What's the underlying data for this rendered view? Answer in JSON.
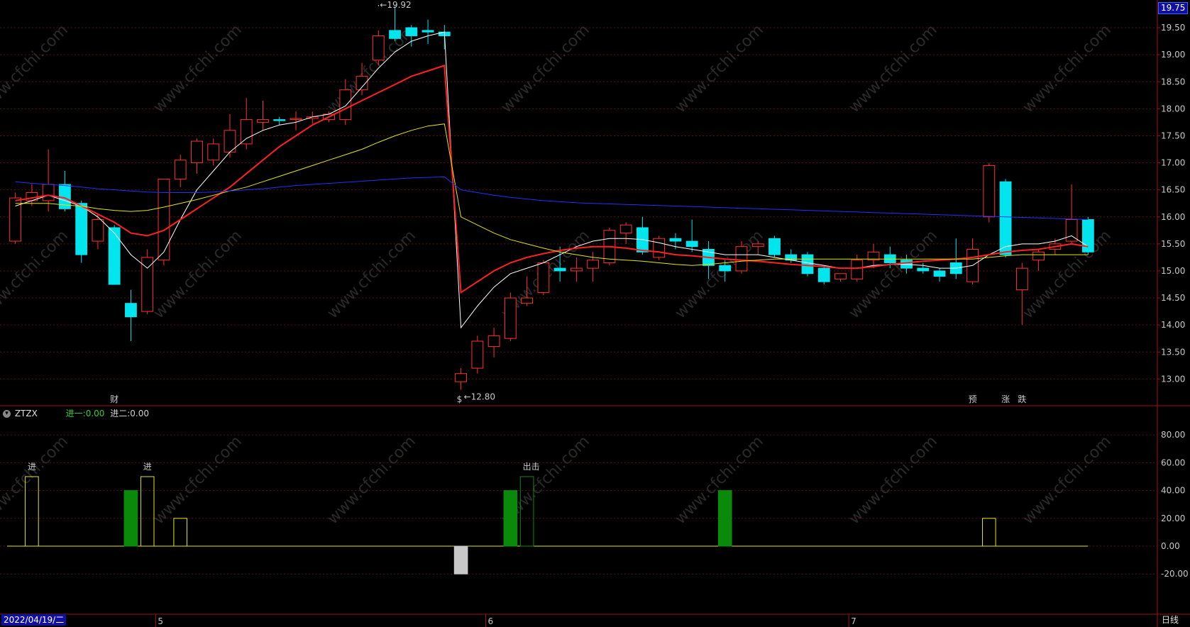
{
  "price_scale": {
    "ticks": [
      "19.50",
      "19.00",
      "18.50",
      "18.00",
      "17.50",
      "17.00",
      "16.50",
      "16.00",
      "15.50",
      "15.00",
      "14.50",
      "14.00",
      "13.50",
      "13.00"
    ],
    "last_price": "19.75",
    "high_label": "19.92",
    "low_label": "12.80",
    "high_arrow": "←19.92",
    "low_arrow": "←12.80"
  },
  "event_markers": [
    {
      "text": "财",
      "color": "#4aa3ff"
    },
    {
      "text": "$",
      "color": "#ff3030"
    },
    {
      "text": "预",
      "color": "#ff8c00"
    },
    {
      "text": "涨",
      "color": "#ff3030"
    },
    {
      "text": "跌",
      "color": "#30ff30"
    }
  ],
  "indicator": {
    "name": "ZTZX",
    "v1_label": "进一:",
    "v1_value": "0.00",
    "v2_label": "进二:",
    "v2_value": "0.00",
    "ticks": [
      "80.00",
      "60.00",
      "40.00",
      "20.00",
      "0.00",
      "-20.00"
    ],
    "annotations": [
      "进",
      "进",
      "出击"
    ]
  },
  "time_axis": {
    "date_label": "2022/04/19/二",
    "month_labels": [
      "5",
      "6",
      "7"
    ],
    "period": "日线"
  },
  "watermark": "www.cfchi.com",
  "chart_data": [
    {
      "type": "candlestick",
      "ylim": [
        12.6,
        19.8
      ],
      "candles": [
        {
          "o": 15.55,
          "h": 16.45,
          "l": 15.5,
          "c": 16.35
        },
        {
          "o": 16.3,
          "h": 16.6,
          "l": 16.2,
          "c": 16.45
        },
        {
          "o": 16.3,
          "h": 17.25,
          "l": 16.1,
          "c": 16.6
        },
        {
          "o": 16.6,
          "h": 16.85,
          "l": 16.1,
          "c": 16.15
        },
        {
          "o": 16.25,
          "h": 16.3,
          "l": 15.15,
          "c": 15.3
        },
        {
          "o": 15.55,
          "h": 16.05,
          "l": 15.4,
          "c": 15.95
        },
        {
          "o": 15.8,
          "h": 15.85,
          "l": 14.75,
          "c": 14.75
        },
        {
          "o": 14.4,
          "h": 14.65,
          "l": 13.7,
          "c": 14.15
        },
        {
          "o": 14.25,
          "h": 15.4,
          "l": 14.2,
          "c": 15.25
        },
        {
          "o": 15.2,
          "h": 16.7,
          "l": 15.1,
          "c": 16.7
        },
        {
          "o": 16.7,
          "h": 17.15,
          "l": 16.55,
          "c": 17.05
        },
        {
          "o": 17.0,
          "h": 17.45,
          "l": 16.8,
          "c": 17.4
        },
        {
          "o": 17.05,
          "h": 17.45,
          "l": 16.95,
          "c": 17.35
        },
        {
          "o": 17.2,
          "h": 17.9,
          "l": 17.1,
          "c": 17.6
        },
        {
          "o": 17.35,
          "h": 18.2,
          "l": 17.25,
          "c": 17.8
        },
        {
          "o": 17.75,
          "h": 18.15,
          "l": 17.6,
          "c": 17.8
        },
        {
          "o": 17.8,
          "h": 17.85,
          "l": 17.7,
          "c": 17.78
        },
        {
          "o": 17.8,
          "h": 17.95,
          "l": 17.6,
          "c": 17.82
        },
        {
          "o": 17.82,
          "h": 17.95,
          "l": 17.72,
          "c": 17.85
        },
        {
          "o": 17.8,
          "h": 17.95,
          "l": 17.75,
          "c": 17.9
        },
        {
          "o": 17.8,
          "h": 18.55,
          "l": 17.7,
          "c": 18.35
        },
        {
          "o": 18.35,
          "h": 18.85,
          "l": 18.25,
          "c": 18.6
        },
        {
          "o": 18.9,
          "h": 19.45,
          "l": 18.8,
          "c": 19.35
        },
        {
          "o": 19.45,
          "h": 19.9,
          "l": 19.25,
          "c": 19.3
        },
        {
          "o": 19.5,
          "h": 19.55,
          "l": 19.15,
          "c": 19.35
        },
        {
          "o": 19.45,
          "h": 19.65,
          "l": 19.2,
          "c": 19.42
        },
        {
          "o": 19.42,
          "h": 19.55,
          "l": 19.1,
          "c": 19.35
        },
        {
          "o": 12.95,
          "h": 13.2,
          "l": 12.8,
          "c": 13.1
        },
        {
          "o": 13.2,
          "h": 13.8,
          "l": 13.1,
          "c": 13.7
        },
        {
          "o": 13.6,
          "h": 13.95,
          "l": 13.4,
          "c": 13.8
        },
        {
          "o": 13.75,
          "h": 14.6,
          "l": 13.7,
          "c": 14.5
        },
        {
          "o": 14.4,
          "h": 14.9,
          "l": 14.35,
          "c": 14.5
        },
        {
          "o": 14.6,
          "h": 15.2,
          "l": 14.55,
          "c": 15.15
        },
        {
          "o": 15.05,
          "h": 15.45,
          "l": 14.8,
          "c": 15.0
        },
        {
          "o": 15.0,
          "h": 15.25,
          "l": 14.8,
          "c": 15.05
        },
        {
          "o": 15.05,
          "h": 15.35,
          "l": 14.8,
          "c": 15.2
        },
        {
          "o": 15.15,
          "h": 15.8,
          "l": 15.1,
          "c": 15.75
        },
        {
          "o": 15.7,
          "h": 15.9,
          "l": 15.5,
          "c": 15.85
        },
        {
          "o": 15.8,
          "h": 16.0,
          "l": 15.3,
          "c": 15.35
        },
        {
          "o": 15.25,
          "h": 15.65,
          "l": 15.2,
          "c": 15.6
        },
        {
          "o": 15.6,
          "h": 15.7,
          "l": 15.4,
          "c": 15.55
        },
        {
          "o": 15.55,
          "h": 15.95,
          "l": 15.35,
          "c": 15.45
        },
        {
          "o": 15.4,
          "h": 15.55,
          "l": 14.85,
          "c": 15.1
        },
        {
          "o": 15.1,
          "h": 15.2,
          "l": 14.8,
          "c": 15.0
        },
        {
          "o": 15.0,
          "h": 15.55,
          "l": 14.95,
          "c": 15.45
        },
        {
          "o": 15.45,
          "h": 15.55,
          "l": 15.3,
          "c": 15.5
        },
        {
          "o": 15.6,
          "h": 15.65,
          "l": 15.25,
          "c": 15.3
        },
        {
          "o": 15.3,
          "h": 15.4,
          "l": 15.15,
          "c": 15.2
        },
        {
          "o": 15.3,
          "h": 15.35,
          "l": 14.9,
          "c": 14.95
        },
        {
          "o": 15.05,
          "h": 15.1,
          "l": 14.75,
          "c": 14.8
        },
        {
          "o": 14.85,
          "h": 14.95,
          "l": 14.8,
          "c": 14.95
        },
        {
          "o": 14.85,
          "h": 15.3,
          "l": 14.8,
          "c": 15.2
        },
        {
          "o": 15.2,
          "h": 15.5,
          "l": 15.05,
          "c": 15.35
        },
        {
          "o": 15.3,
          "h": 15.45,
          "l": 15.05,
          "c": 15.15
        },
        {
          "o": 15.2,
          "h": 15.3,
          "l": 14.95,
          "c": 15.05
        },
        {
          "o": 15.05,
          "h": 15.15,
          "l": 14.95,
          "c": 15.0
        },
        {
          "o": 15.0,
          "h": 15.05,
          "l": 14.8,
          "c": 14.9
        },
        {
          "o": 15.15,
          "h": 15.6,
          "l": 14.85,
          "c": 14.95
        },
        {
          "o": 14.8,
          "h": 15.6,
          "l": 14.75,
          "c": 15.4
        },
        {
          "o": 16.0,
          "h": 17.0,
          "l": 15.9,
          "c": 16.95
        },
        {
          "o": 16.65,
          "h": 16.7,
          "l": 15.25,
          "c": 15.3
        },
        {
          "o": 14.65,
          "h": 15.15,
          "l": 14.0,
          "c": 15.05
        },
        {
          "o": 15.2,
          "h": 15.4,
          "l": 15.0,
          "c": 15.35
        },
        {
          "o": 15.4,
          "h": 15.6,
          "l": 15.3,
          "c": 15.5
        },
        {
          "o": 15.55,
          "h": 16.6,
          "l": 15.5,
          "c": 15.95
        },
        {
          "o": 15.95,
          "h": 16.0,
          "l": 15.3,
          "c": 15.35
        }
      ],
      "lines": [
        {
          "name": "MA5",
          "color": "#ffffff",
          "values": [
            16.2,
            16.3,
            16.4,
            16.3,
            16.2,
            16.0,
            15.7,
            15.3,
            15.05,
            15.35,
            15.95,
            16.5,
            16.85,
            17.2,
            17.45,
            17.6,
            17.7,
            17.75,
            17.85,
            17.9,
            18.05,
            18.4,
            18.75,
            19.05,
            19.25,
            19.35,
            19.42,
            13.95,
            14.35,
            14.7,
            14.95,
            15.05,
            15.15,
            15.3,
            15.45,
            15.55,
            15.6,
            15.6,
            15.58,
            15.52,
            15.45,
            15.4,
            15.35,
            15.3,
            15.3,
            15.3,
            15.25,
            15.2,
            15.15,
            15.1,
            15.05,
            15.05,
            15.1,
            15.12,
            15.12,
            15.1,
            15.05,
            15.05,
            15.1,
            15.3,
            15.45,
            15.5,
            15.5,
            15.55,
            15.65,
            15.45
          ]
        },
        {
          "name": "MA10",
          "color": "#ff2020",
          "values": [
            16.3,
            16.35,
            16.4,
            16.35,
            16.2,
            16.05,
            15.9,
            15.7,
            15.65,
            15.75,
            15.95,
            16.15,
            16.35,
            16.55,
            16.8,
            17.05,
            17.3,
            17.5,
            17.7,
            17.85,
            18.0,
            18.15,
            18.3,
            18.45,
            18.6,
            18.7,
            18.8,
            14.6,
            14.8,
            15.0,
            15.15,
            15.25,
            15.32,
            15.38,
            15.42,
            15.45,
            15.45,
            15.42,
            15.38,
            15.35,
            15.3,
            15.28,
            15.25,
            15.22,
            15.2,
            15.18,
            15.15,
            15.12,
            15.1,
            15.08,
            15.05,
            15.05,
            15.08,
            15.12,
            15.15,
            15.18,
            15.2,
            15.22,
            15.25,
            15.3,
            15.35,
            15.38,
            15.4,
            15.45,
            15.5,
            15.45
          ]
        },
        {
          "name": "MA20",
          "color": "#e6e600",
          "values": [
            16.25,
            16.25,
            16.25,
            16.22,
            16.2,
            16.15,
            16.12,
            16.1,
            16.12,
            16.18,
            16.25,
            16.32,
            16.4,
            16.48,
            16.55,
            16.65,
            16.75,
            16.85,
            16.95,
            17.05,
            17.15,
            17.25,
            17.38,
            17.5,
            17.6,
            17.68,
            17.72,
            16.0,
            15.85,
            15.7,
            15.58,
            15.5,
            15.42,
            15.35,
            15.3,
            15.25,
            15.22,
            15.2,
            15.18,
            15.15,
            15.12,
            15.1,
            15.12,
            15.15,
            15.18,
            15.2,
            15.22,
            15.22,
            15.22,
            15.22,
            15.22,
            15.22,
            15.22,
            15.22,
            15.22,
            15.22,
            15.22,
            15.22,
            15.22,
            15.25,
            15.28,
            15.3,
            15.3,
            15.3,
            15.3,
            15.3
          ]
        },
        {
          "name": "MA60",
          "color": "#2030ff",
          "values": [
            16.65,
            16.62,
            16.6,
            16.58,
            16.55,
            16.52,
            16.5,
            16.48,
            16.46,
            16.45,
            16.45,
            16.45,
            16.46,
            16.48,
            16.5,
            16.52,
            16.55,
            16.58,
            16.6,
            16.62,
            16.64,
            16.66,
            16.68,
            16.7,
            16.72,
            16.73,
            16.74,
            16.5,
            16.45,
            16.4,
            16.36,
            16.33,
            16.3,
            16.28,
            16.26,
            16.25,
            16.24,
            16.23,
            16.22,
            16.21,
            16.2,
            16.19,
            16.18,
            16.17,
            16.16,
            16.15,
            16.14,
            16.13,
            16.12,
            16.11,
            16.1,
            16.09,
            16.08,
            16.07,
            16.06,
            16.05,
            16.04,
            16.03,
            16.02,
            16.01,
            16.0,
            15.99,
            15.98,
            15.97,
            15.96,
            15.95
          ]
        }
      ]
    },
    {
      "type": "bar",
      "series_name": "ZTZX",
      "ylim": [
        -25,
        95
      ],
      "bars": [
        {
          "i": 1,
          "value": 50,
          "style": "outline",
          "color": "#e6e600"
        },
        {
          "i": 7,
          "value": 40,
          "style": "fill",
          "color": "#0a8a0a"
        },
        {
          "i": 8,
          "value": 50,
          "style": "outline",
          "color": "#e6e600"
        },
        {
          "i": 10,
          "value": 20,
          "style": "outline",
          "color": "#e6e600"
        },
        {
          "i": 27,
          "value": -20,
          "style": "fill",
          "color": "#c8c8c8"
        },
        {
          "i": 30,
          "value": 40,
          "style": "fill",
          "color": "#0a8a0a"
        },
        {
          "i": 31,
          "value": 50,
          "style": "outline",
          "color": "#0a8a0a"
        },
        {
          "i": 43,
          "value": 40,
          "style": "fill",
          "color": "#0a8a0a"
        },
        {
          "i": 59,
          "value": 20,
          "style": "outline",
          "color": "#e6e600"
        }
      ],
      "line": {
        "color": "#e6e600",
        "value": 0
      }
    }
  ]
}
